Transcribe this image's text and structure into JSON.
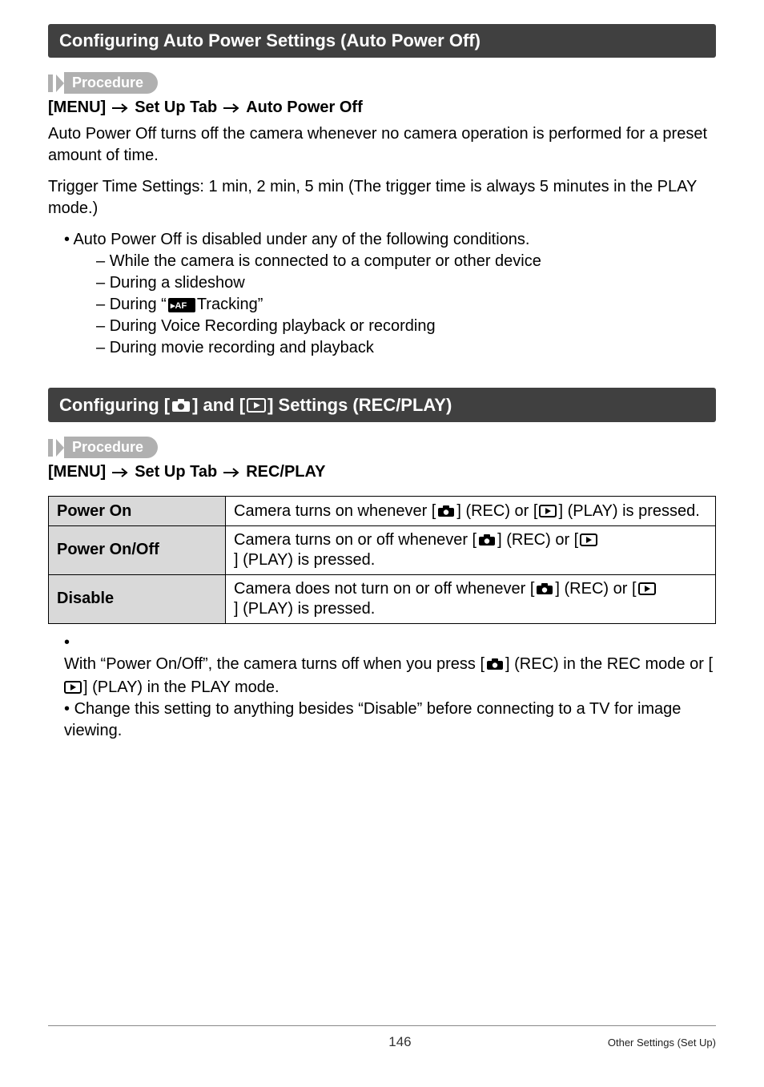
{
  "section1": {
    "heading": "Configuring Auto Power Settings (Auto Power Off)",
    "procedure_label": "Procedure",
    "menu_parts": [
      "[MENU]",
      "Set Up Tab",
      "Auto Power Off"
    ],
    "para1": "Auto Power Off turns off the camera whenever no camera operation is performed for a preset amount of time.",
    "para2": "Trigger Time Settings: 1 min, 2 min, 5 min (The trigger time is always 5 minutes in the PLAY mode.)",
    "bullet_intro": "Auto Power Off is disabled under any of the following conditions.",
    "dashes": [
      "While the camera is connected to a computer or other device",
      "During a slideshow",
      "__TRACKING__",
      "During Voice Recording playback or recording",
      "During movie recording and playback"
    ],
    "tracking_prefix": "During “",
    "tracking_suffix": " Tracking”"
  },
  "section2": {
    "heading_prefix": "Configuring [",
    "heading_mid": "] and [",
    "heading_suffix": "] Settings (REC/PLAY)",
    "procedure_label": "Procedure",
    "menu_parts": [
      "[MENU]",
      "Set Up Tab",
      "REC/PLAY"
    ],
    "rows": [
      {
        "label": "Power On",
        "pre": "Camera turns on whenever [",
        "mid": "] (REC) or [",
        "post": "] (PLAY) is pressed."
      },
      {
        "label": "Power On/Off",
        "pre": "Camera turns on or off whenever [",
        "mid": "] (REC) or [",
        "post": "] (PLAY) is pressed."
      },
      {
        "label": "Disable",
        "pre": "Camera does not turn on or off whenever [",
        "mid": "] (REC) or [",
        "post": "] (PLAY) is pressed."
      }
    ],
    "note1_pre": "With “Power On/Off”, the camera turns off when you press [",
    "note1_mid": "] (REC) in the REC mode or [",
    "note1_post": "] (PLAY) in the PLAY mode.",
    "note2": "Change this setting to anything besides “Disable” before connecting to a TV for image viewing."
  },
  "footer": {
    "page": "146",
    "section": "Other Settings (Set Up)"
  },
  "icons": {
    "camera": "camera-icon",
    "play": "play-icon",
    "af_badge": "af-tracking-icon"
  }
}
